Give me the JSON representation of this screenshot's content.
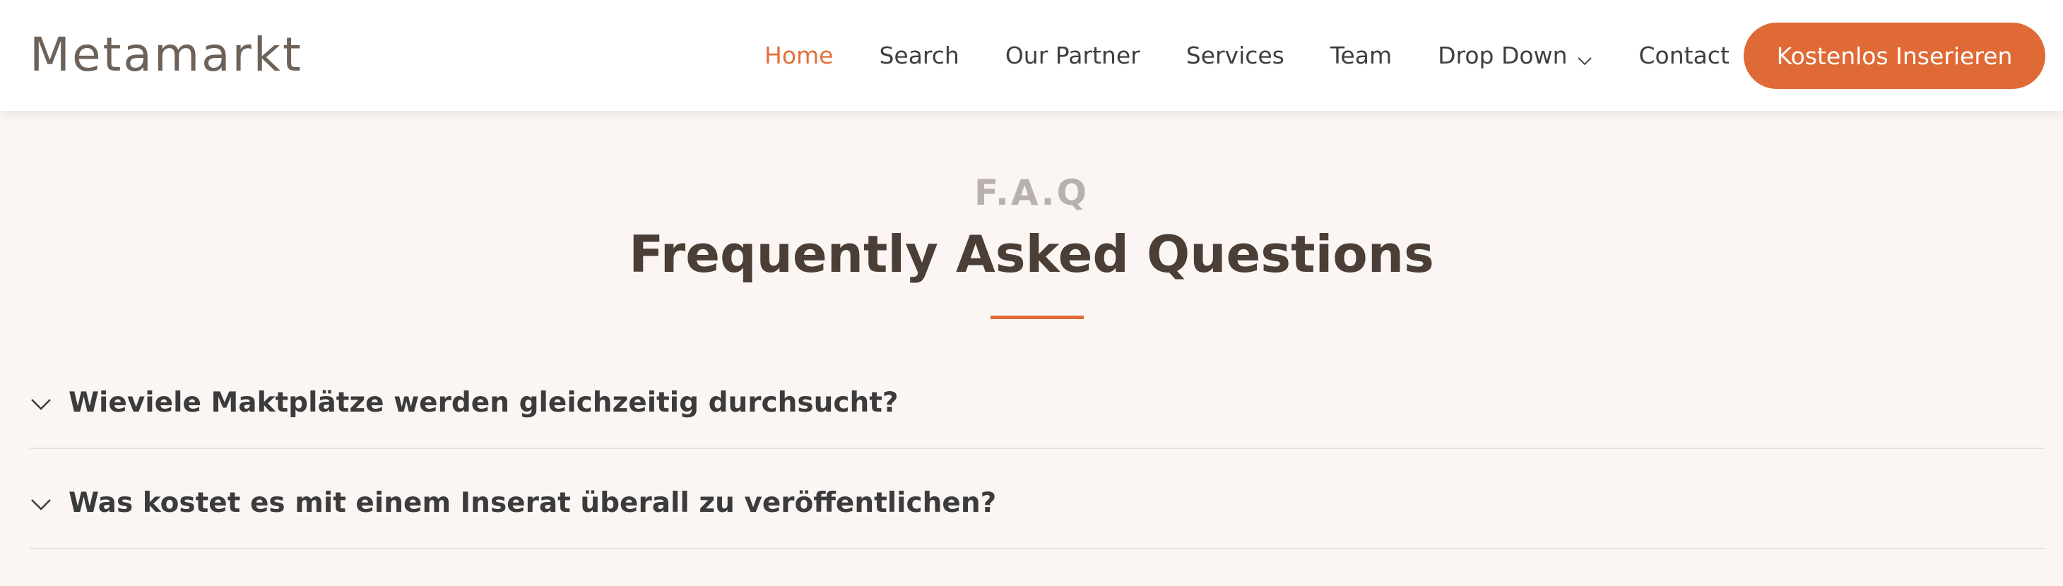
{
  "brand": {
    "logo_text": "Metamarkt"
  },
  "nav": {
    "items": [
      {
        "label": "Home",
        "active": true
      },
      {
        "label": "Search"
      },
      {
        "label": "Our Partner"
      },
      {
        "label": "Services"
      },
      {
        "label": "Team"
      },
      {
        "label": "Drop Down",
        "icon": "chevron-down-icon"
      },
      {
        "label": "Contact"
      }
    ],
    "cta_label": "Kostenlos Inserieren"
  },
  "faq": {
    "kicker": "F.A.Q",
    "title": "Frequently Asked Questions",
    "questions": [
      {
        "text": "Wieviele Maktplätze werden gleichzeitig durchsucht?",
        "icon": "chevron-down-icon"
      },
      {
        "text": "Was kostet es mit einem Inserat überall zu veröffentlichen?",
        "icon": "chevron-down-icon"
      }
    ]
  },
  "colors": {
    "accent": "#df6a35",
    "background": "#fbf6f3",
    "heading": "#4a3e36",
    "kicker": "#b9b1ab"
  }
}
